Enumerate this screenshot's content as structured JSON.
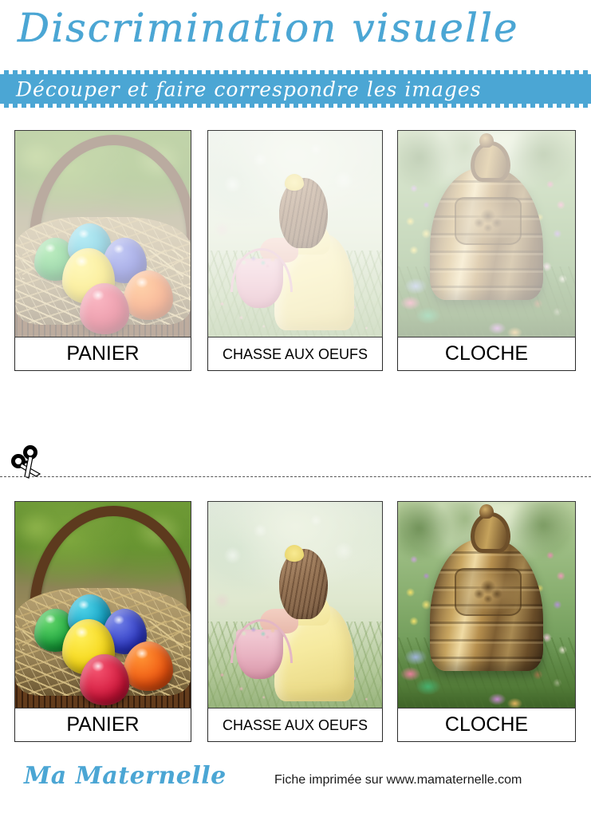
{
  "header": {
    "title": "Discrimination visuelle",
    "instruction": "Découper et faire correspondre les images",
    "accent_color": "#4BA6D4",
    "banner_text_color": "#FFFFFF"
  },
  "cut_section": {
    "scissors_icon": "scissors-icon",
    "cut_line_style": "dashed"
  },
  "rows": [
    {
      "id": "model-row",
      "faded": true,
      "cards": [
        {
          "label": "PANIER",
          "image": "basket-with-colored-eggs"
        },
        {
          "label": "CHASSE AUX OEUFS",
          "image": "girl-with-easter-basket"
        },
        {
          "label": "CLOCHE",
          "image": "bronze-bell-in-flower-garden"
        }
      ]
    },
    {
      "id": "cut-out-row",
      "faded": false,
      "cards": [
        {
          "label": "PANIER",
          "image": "basket-with-colored-eggs"
        },
        {
          "label": "CHASSE AUX OEUFS",
          "image": "girl-with-easter-basket"
        },
        {
          "label": "CLOCHE",
          "image": "bronze-bell-in-flower-garden"
        }
      ]
    }
  ],
  "footer": {
    "logo": "Ma Maternelle",
    "note": "Fiche imprimée sur www.mamaternelle.com"
  }
}
